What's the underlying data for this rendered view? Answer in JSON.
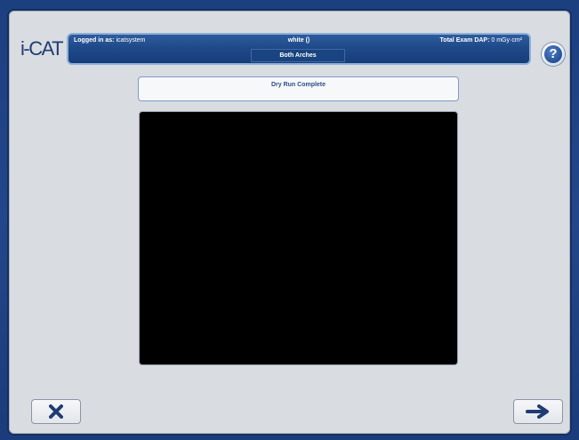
{
  "app": {
    "logo_text": "i-CAT"
  },
  "header": {
    "login_label": "Logged in as:",
    "login_user": "icatsystem",
    "patient": "white ()",
    "dap_label": "Total Exam DAP:",
    "dap_value": "0 mGy·cm²",
    "scan_type": "Both Arches"
  },
  "status": {
    "message": "Dry Run Complete"
  },
  "buttons": {
    "help": "?",
    "cancel_icon": "close-icon",
    "next_icon": "arrow-right-icon"
  },
  "colors": {
    "background": "#1c3f80",
    "panel": "#d9dce1",
    "header": "#1f4a8a",
    "accent": "#2b4f8a",
    "preview": "#000000"
  }
}
